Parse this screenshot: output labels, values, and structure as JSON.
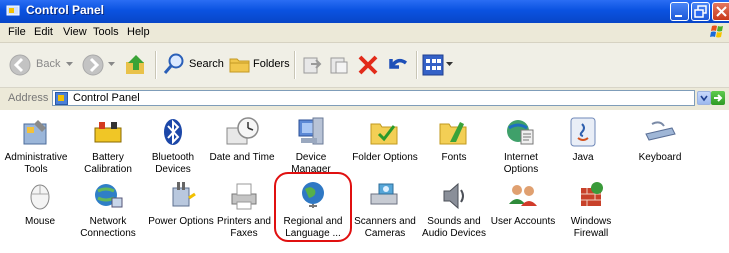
{
  "window": {
    "title": "Control Panel"
  },
  "menu": {
    "items": [
      "File",
      "Edit",
      "View",
      "Tools",
      "Help"
    ]
  },
  "toolbar": {
    "back_label": "Back",
    "search_label": "Search",
    "folders_label": "Folders"
  },
  "address": {
    "label": "Address",
    "value": "Control Panel",
    "go_label": "Go"
  },
  "items": [
    {
      "label1": "Administrative",
      "label2": "Tools",
      "icon": "administrative-tools-icon"
    },
    {
      "label1": "Battery",
      "label2": "Calibration",
      "icon": "battery-icon"
    },
    {
      "label1": "Bluetooth",
      "label2": "Devices",
      "icon": "bluetooth-icon"
    },
    {
      "label1": "Date and Time",
      "label2": "",
      "icon": "clock-icon"
    },
    {
      "label1": "Device",
      "label2": "Manager",
      "icon": "device-manager-icon"
    },
    {
      "label1": "Folder Options",
      "label2": "",
      "icon": "folder-options-icon"
    },
    {
      "label1": "Fonts",
      "label2": "",
      "icon": "fonts-folder-icon"
    },
    {
      "label1": "Internet",
      "label2": "Options",
      "icon": "internet-options-icon"
    },
    {
      "label1": "Java",
      "label2": "",
      "icon": "java-icon"
    },
    {
      "label1": "Keyboard",
      "label2": "",
      "icon": "keyboard-icon"
    },
    {
      "label1": "Mouse",
      "label2": "",
      "icon": "mouse-icon"
    },
    {
      "label1": "Network",
      "label2": "Connections",
      "icon": "network-icon"
    },
    {
      "label1": "Power Options",
      "label2": "",
      "icon": "power-icon"
    },
    {
      "label1": "Printers and",
      "label2": "Faxes",
      "icon": "printer-icon"
    },
    {
      "label1": "Regional and",
      "label2": "Language ...",
      "icon": "globe-icon"
    },
    {
      "label1": "Scanners and",
      "label2": "Cameras",
      "icon": "scanner-icon"
    },
    {
      "label1": "Sounds and",
      "label2": "Audio Devices",
      "icon": "speaker-icon"
    },
    {
      "label1": "User Accounts",
      "label2": "",
      "icon": "users-icon"
    },
    {
      "label1": "Windows",
      "label2": "Firewall",
      "icon": "firewall-icon"
    }
  ]
}
